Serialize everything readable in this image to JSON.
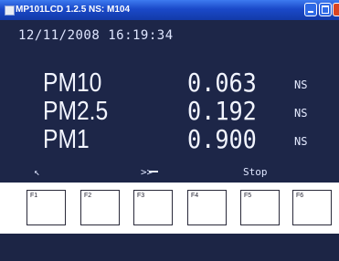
{
  "window": {
    "title": "MP101LCD 1.2.5  NS: M104"
  },
  "display": {
    "datetime": "12/11/2008 16:19:34",
    "readings": [
      {
        "label": "PM10",
        "value": "0.063",
        "flag": "NS"
      },
      {
        "label": "PM2.5",
        "value": "0.192",
        "flag": "NS"
      },
      {
        "label": "PM1",
        "value": "0.900",
        "flag": "NS"
      }
    ],
    "controls": {
      "back": "↖",
      "next": ">>",
      "stop": "Stop"
    }
  },
  "function_keys": [
    "F1",
    "F2",
    "F3",
    "F4",
    "F5",
    "F6"
  ]
}
